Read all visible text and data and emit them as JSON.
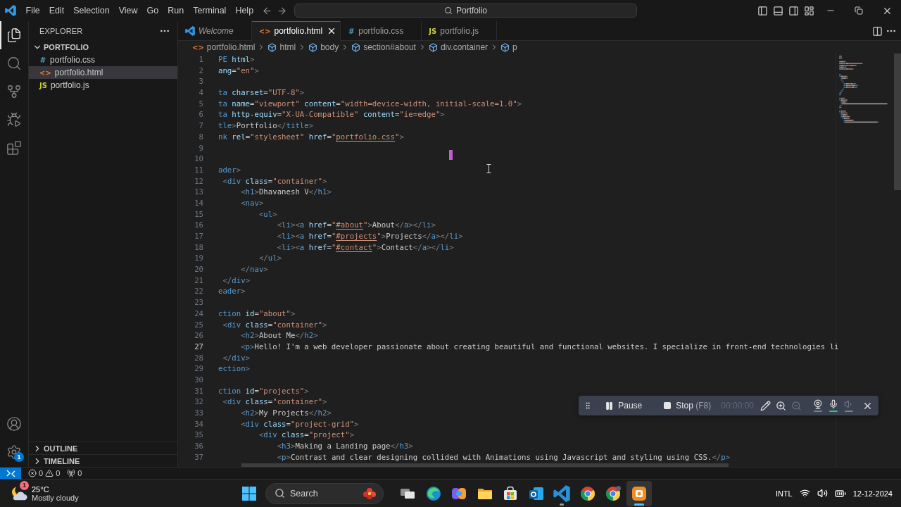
{
  "title_bar": {
    "menu": [
      "File",
      "Edit",
      "Selection",
      "View",
      "Go",
      "Run",
      "Terminal",
      "Help"
    ],
    "command_center": {
      "label": "Portfolio"
    }
  },
  "activity_bar": {
    "items": [
      {
        "kind": "explorer",
        "selected": true
      },
      {
        "kind": "search",
        "selected": false
      },
      {
        "kind": "source_control",
        "selected": false
      },
      {
        "kind": "run_debug",
        "selected": false
      },
      {
        "kind": "extensions",
        "selected": false
      }
    ],
    "settings_badge": "1"
  },
  "sidebar": {
    "title": "EXPLORER",
    "folder": {
      "name": "PORTFOLIO",
      "expanded": true,
      "files": [
        {
          "kind": "css",
          "icon": "#",
          "name": "portfolio.css",
          "selected": false
        },
        {
          "kind": "html",
          "icon": "<>",
          "name": "portfolio.html",
          "selected": true
        },
        {
          "kind": "js",
          "icon": "JS",
          "name": "portfolio.js",
          "selected": false
        }
      ]
    },
    "sections": [
      {
        "name": "OUTLINE",
        "expanded": false
      },
      {
        "name": "TIMELINE",
        "expanded": false
      }
    ]
  },
  "editor": {
    "tabs": [
      {
        "kind": "welcome",
        "label": "Welcome",
        "selected": false
      },
      {
        "kind": "html",
        "icon": "<>",
        "label": "portfolio.html",
        "selected": true
      },
      {
        "kind": "css",
        "icon": "#",
        "label": "portfolio.css",
        "selected": false
      },
      {
        "kind": "js",
        "icon": "JS",
        "label": "portfolio.js",
        "selected": false
      }
    ],
    "breadcrumbs": [
      {
        "kind": "file",
        "icon": "<>",
        "label": "portfolio.html"
      },
      {
        "kind": "element",
        "label": "html"
      },
      {
        "kind": "element",
        "label": "body"
      },
      {
        "kind": "element",
        "label": "section#about"
      },
      {
        "kind": "element",
        "label": "div.container"
      },
      {
        "kind": "element",
        "label": "p"
      }
    ],
    "lines": [
      {
        "number": "1",
        "active": false,
        "tokens": [
          {
            "kind": "tag",
            "text": "PE"
          },
          {
            "kind": "attr",
            "text": " html"
          },
          {
            "kind": "punct",
            "text": ">"
          }
        ]
      },
      {
        "number": "2",
        "active": false,
        "tokens": [
          {
            "kind": "attr",
            "text": "ang"
          },
          {
            "kind": "text",
            "text": "="
          },
          {
            "kind": "str",
            "text": "\"en\""
          },
          {
            "kind": "punct",
            "text": ">"
          }
        ]
      },
      {
        "number": "3",
        "active": false
      },
      {
        "number": "4",
        "active": false,
        "tokens": [
          {
            "kind": "tag",
            "text": "ta"
          },
          {
            "kind": "attr",
            "text": " charset"
          },
          {
            "kind": "text",
            "text": "="
          },
          {
            "kind": "str",
            "text": "\"UTF-8\""
          },
          {
            "kind": "punct",
            "text": ">"
          }
        ]
      },
      {
        "number": "5",
        "active": false,
        "tokens": [
          {
            "kind": "tag",
            "text": "ta"
          },
          {
            "kind": "attr",
            "text": " name"
          },
          {
            "kind": "text",
            "text": "="
          },
          {
            "kind": "str",
            "text": "\"viewport\""
          },
          {
            "kind": "attr",
            "text": " content"
          },
          {
            "kind": "text",
            "text": "="
          },
          {
            "kind": "str",
            "text": "\"width=device-width, initial-scale=1.0\""
          },
          {
            "kind": "punct",
            "text": ">"
          }
        ]
      },
      {
        "number": "6",
        "active": false,
        "tokens": [
          {
            "kind": "tag",
            "text": "ta"
          },
          {
            "kind": "attr",
            "text": " http-equiv"
          },
          {
            "kind": "text",
            "text": "="
          },
          {
            "kind": "str",
            "text": "\"X-UA-Compatible\""
          },
          {
            "kind": "attr",
            "text": " content"
          },
          {
            "kind": "text",
            "text": "="
          },
          {
            "kind": "str",
            "text": "\"ie=edge\""
          },
          {
            "kind": "punct",
            "text": ">"
          }
        ]
      },
      {
        "number": "7",
        "active": false,
        "tokens": [
          {
            "kind": "tag",
            "text": "tle"
          },
          {
            "kind": "punct",
            "text": ">"
          },
          {
            "kind": "text",
            "text": "Portfolio"
          },
          {
            "kind": "punct",
            "text": "</"
          },
          {
            "kind": "tag",
            "text": "title"
          },
          {
            "kind": "punct",
            "text": ">"
          }
        ]
      },
      {
        "number": "8",
        "active": false,
        "tokens": [
          {
            "kind": "tag",
            "text": "nk"
          },
          {
            "kind": "attr",
            "text": " rel"
          },
          {
            "kind": "text",
            "text": "="
          },
          {
            "kind": "str",
            "text": "\"stylesheet\""
          },
          {
            "kind": "attr",
            "text": " href"
          },
          {
            "kind": "text",
            "text": "="
          },
          {
            "kind": "str",
            "text": "\""
          },
          {
            "kind": "link",
            "text": "portfolio.css"
          },
          {
            "kind": "str",
            "text": "\""
          },
          {
            "kind": "punct",
            "text": ">"
          }
        ]
      },
      {
        "number": "9",
        "active": false
      },
      {
        "number": "10",
        "active": false
      },
      {
        "number": "11",
        "active": false,
        "tokens": [
          {
            "kind": "tag",
            "text": "ader"
          },
          {
            "kind": "punct",
            "text": ">"
          }
        ]
      },
      {
        "number": "12",
        "active": false,
        "tokens": [
          {
            "kind": "punct",
            "text": " <"
          },
          {
            "kind": "tag",
            "text": "div"
          },
          {
            "kind": "attr",
            "text": " class"
          },
          {
            "kind": "text",
            "text": "="
          },
          {
            "kind": "str",
            "text": "\"container\""
          },
          {
            "kind": "punct",
            "text": ">"
          }
        ]
      },
      {
        "number": "13",
        "active": false,
        "tokens": [
          {
            "kind": "punct",
            "text": "     <"
          },
          {
            "kind": "tag",
            "text": "h1"
          },
          {
            "kind": "punct",
            "text": ">"
          },
          {
            "kind": "text",
            "text": "Dhavanesh V"
          },
          {
            "kind": "punct",
            "text": "</"
          },
          {
            "kind": "tag",
            "text": "h1"
          },
          {
            "kind": "punct",
            "text": ">"
          }
        ]
      },
      {
        "number": "14",
        "active": false,
        "tokens": [
          {
            "kind": "punct",
            "text": "     <"
          },
          {
            "kind": "tag",
            "text": "nav"
          },
          {
            "kind": "punct",
            "text": ">"
          }
        ]
      },
      {
        "number": "15",
        "active": false,
        "tokens": [
          {
            "kind": "punct",
            "text": "         <"
          },
          {
            "kind": "tag",
            "text": "ul"
          },
          {
            "kind": "punct",
            "text": ">"
          }
        ]
      },
      {
        "number": "16",
        "active": false,
        "tokens": [
          {
            "kind": "punct",
            "text": "             <"
          },
          {
            "kind": "tag",
            "text": "li"
          },
          {
            "kind": "punct",
            "text": "><"
          },
          {
            "kind": "tag",
            "text": "a"
          },
          {
            "kind": "attr",
            "text": " href"
          },
          {
            "kind": "text",
            "text": "="
          },
          {
            "kind": "str",
            "text": "\""
          },
          {
            "kind": "link",
            "text": "#about"
          },
          {
            "kind": "str",
            "text": "\""
          },
          {
            "kind": "punct",
            "text": ">"
          },
          {
            "kind": "text",
            "text": "About"
          },
          {
            "kind": "punct",
            "text": "</"
          },
          {
            "kind": "tag",
            "text": "a"
          },
          {
            "kind": "punct",
            "text": "></"
          },
          {
            "kind": "tag",
            "text": "li"
          },
          {
            "kind": "punct",
            "text": ">"
          }
        ]
      },
      {
        "number": "17",
        "active": false,
        "tokens": [
          {
            "kind": "punct",
            "text": "             <"
          },
          {
            "kind": "tag",
            "text": "li"
          },
          {
            "kind": "punct",
            "text": "><"
          },
          {
            "kind": "tag",
            "text": "a"
          },
          {
            "kind": "attr",
            "text": " href"
          },
          {
            "kind": "text",
            "text": "="
          },
          {
            "kind": "str",
            "text": "\""
          },
          {
            "kind": "link",
            "text": "#projects"
          },
          {
            "kind": "str",
            "text": "\""
          },
          {
            "kind": "punct",
            "text": ">"
          },
          {
            "kind": "text",
            "text": "Projects"
          },
          {
            "kind": "punct",
            "text": "</"
          },
          {
            "kind": "tag",
            "text": "a"
          },
          {
            "kind": "punct",
            "text": "></"
          },
          {
            "kind": "tag",
            "text": "li"
          },
          {
            "kind": "punct",
            "text": ">"
          }
        ]
      },
      {
        "number": "18",
        "active": false,
        "tokens": [
          {
            "kind": "punct",
            "text": "             <"
          },
          {
            "kind": "tag",
            "text": "li"
          },
          {
            "kind": "punct",
            "text": "><"
          },
          {
            "kind": "tag",
            "text": "a"
          },
          {
            "kind": "attr",
            "text": " href"
          },
          {
            "kind": "text",
            "text": "="
          },
          {
            "kind": "str",
            "text": "\""
          },
          {
            "kind": "link",
            "text": "#contact"
          },
          {
            "kind": "str",
            "text": "\""
          },
          {
            "kind": "punct",
            "text": ">"
          },
          {
            "kind": "text",
            "text": "Contact"
          },
          {
            "kind": "punct",
            "text": "</"
          },
          {
            "kind": "tag",
            "text": "a"
          },
          {
            "kind": "punct",
            "text": "></"
          },
          {
            "kind": "tag",
            "text": "li"
          },
          {
            "kind": "punct",
            "text": ">"
          }
        ]
      },
      {
        "number": "19",
        "active": false,
        "tokens": [
          {
            "kind": "punct",
            "text": "         </"
          },
          {
            "kind": "tag",
            "text": "ul"
          },
          {
            "kind": "punct",
            "text": ">"
          }
        ]
      },
      {
        "number": "20",
        "active": false,
        "tokens": [
          {
            "kind": "punct",
            "text": "     </"
          },
          {
            "kind": "tag",
            "text": "nav"
          },
          {
            "kind": "punct",
            "text": ">"
          }
        ]
      },
      {
        "number": "21",
        "active": false,
        "tokens": [
          {
            "kind": "punct",
            "text": " </"
          },
          {
            "kind": "tag",
            "text": "div"
          },
          {
            "kind": "punct",
            "text": ">"
          }
        ]
      },
      {
        "number": "22",
        "active": false,
        "tokens": [
          {
            "kind": "tag",
            "text": "eader"
          },
          {
            "kind": "punct",
            "text": ">"
          }
        ]
      },
      {
        "number": "23",
        "active": false
      },
      {
        "number": "24",
        "active": false,
        "tokens": [
          {
            "kind": "tag",
            "text": "ction"
          },
          {
            "kind": "attr",
            "text": " id"
          },
          {
            "kind": "text",
            "text": "="
          },
          {
            "kind": "str",
            "text": "\"about\""
          },
          {
            "kind": "punct",
            "text": ">"
          }
        ]
      },
      {
        "number": "25",
        "active": false,
        "tokens": [
          {
            "kind": "punct",
            "text": " <"
          },
          {
            "kind": "tag",
            "text": "div"
          },
          {
            "kind": "attr",
            "text": " class"
          },
          {
            "kind": "text",
            "text": "="
          },
          {
            "kind": "str",
            "text": "\"container\""
          },
          {
            "kind": "punct",
            "text": ">"
          }
        ]
      },
      {
        "number": "26",
        "active": false,
        "tokens": [
          {
            "kind": "punct",
            "text": "     <"
          },
          {
            "kind": "tag",
            "text": "h2"
          },
          {
            "kind": "punct",
            "text": ">"
          },
          {
            "kind": "text",
            "text": "About Me"
          },
          {
            "kind": "punct",
            "text": "</"
          },
          {
            "kind": "tag",
            "text": "h2"
          },
          {
            "kind": "punct",
            "text": ">"
          }
        ]
      },
      {
        "number": "27",
        "active": true,
        "tokens": [
          {
            "kind": "punct",
            "text": "     <"
          },
          {
            "kind": "tag",
            "text": "p"
          },
          {
            "kind": "punct",
            "text": ">"
          },
          {
            "kind": "text",
            "text": "Hello! I'm a web developer passionate about creating beautiful and functional websites. I specialize in front-end technologies li"
          }
        ]
      },
      {
        "number": "28",
        "active": false,
        "tokens": [
          {
            "kind": "punct",
            "text": " </"
          },
          {
            "kind": "tag",
            "text": "div"
          },
          {
            "kind": "punct",
            "text": ">"
          }
        ]
      },
      {
        "number": "29",
        "active": false,
        "tokens": [
          {
            "kind": "tag",
            "text": "ection"
          },
          {
            "kind": "punct",
            "text": ">"
          }
        ]
      },
      {
        "number": "30",
        "active": false
      },
      {
        "number": "31",
        "active": false,
        "tokens": [
          {
            "kind": "tag",
            "text": "ction"
          },
          {
            "kind": "attr",
            "text": " id"
          },
          {
            "kind": "text",
            "text": "="
          },
          {
            "kind": "str",
            "text": "\"projects\""
          },
          {
            "kind": "punct",
            "text": ">"
          }
        ]
      },
      {
        "number": "32",
        "active": false,
        "tokens": [
          {
            "kind": "punct",
            "text": " <"
          },
          {
            "kind": "tag",
            "text": "div"
          },
          {
            "kind": "attr",
            "text": " class"
          },
          {
            "kind": "text",
            "text": "="
          },
          {
            "kind": "str",
            "text": "\"container\""
          },
          {
            "kind": "punct",
            "text": ">"
          }
        ]
      },
      {
        "number": "33",
        "active": false,
        "tokens": [
          {
            "kind": "punct",
            "text": "     <"
          },
          {
            "kind": "tag",
            "text": "h2"
          },
          {
            "kind": "punct",
            "text": ">"
          },
          {
            "kind": "text",
            "text": "My Projects"
          },
          {
            "kind": "punct",
            "text": "</"
          },
          {
            "kind": "tag",
            "text": "h2"
          },
          {
            "kind": "punct",
            "text": ">"
          }
        ]
      },
      {
        "number": "34",
        "active": false,
        "tokens": [
          {
            "kind": "punct",
            "text": "     <"
          },
          {
            "kind": "tag",
            "text": "div"
          },
          {
            "kind": "attr",
            "text": " class"
          },
          {
            "kind": "text",
            "text": "="
          },
          {
            "kind": "str",
            "text": "\"project-grid\""
          },
          {
            "kind": "punct",
            "text": ">"
          }
        ]
      },
      {
        "number": "35",
        "active": false,
        "tokens": [
          {
            "kind": "punct",
            "text": "         <"
          },
          {
            "kind": "tag",
            "text": "div"
          },
          {
            "kind": "attr",
            "text": " class"
          },
          {
            "kind": "text",
            "text": "="
          },
          {
            "kind": "str",
            "text": "\"project\""
          },
          {
            "kind": "punct",
            "text": ">"
          }
        ]
      },
      {
        "number": "36",
        "active": false,
        "tokens": [
          {
            "kind": "punct",
            "text": "             <"
          },
          {
            "kind": "tag",
            "text": "h3"
          },
          {
            "kind": "punct",
            "text": ">"
          },
          {
            "kind": "text",
            "text": "Making a Landing page"
          },
          {
            "kind": "punct",
            "text": "</"
          },
          {
            "kind": "tag",
            "text": "h3"
          },
          {
            "kind": "punct",
            "text": ">"
          }
        ]
      },
      {
        "number": "37",
        "active": false,
        "tokens": [
          {
            "kind": "punct",
            "text": "             <"
          },
          {
            "kind": "tag",
            "text": "p"
          },
          {
            "kind": "punct",
            "text": ">"
          },
          {
            "kind": "text",
            "text": "Contrast and clear designing collided with Animations using Javascript and styling using CSS."
          },
          {
            "kind": "punct",
            "text": "</"
          },
          {
            "kind": "tag",
            "text": "p"
          },
          {
            "kind": "punct",
            "text": ">"
          }
        ]
      }
    ]
  },
  "status_bar": {
    "errors": "0",
    "warnings": "0",
    "ports": "0"
  },
  "recorder": {
    "pause": "Pause",
    "stop": "Stop",
    "stop_shortcut": "(F8)",
    "timer": "00:00:00",
    "tools": [
      {
        "kind": "pencil",
        "disabled": false
      },
      {
        "kind": "zoom_in",
        "disabled": false
      },
      {
        "kind": "zoom_out",
        "disabled": true
      }
    ],
    "toggles": [
      {
        "kind": "webcam",
        "on": false,
        "disabled": false
      },
      {
        "kind": "microphone",
        "on": true,
        "disabled": false
      },
      {
        "kind": "speaker",
        "on": false,
        "disabled": true
      }
    ]
  },
  "taskbar": {
    "weather": {
      "temperature": "25°C",
      "condition": "Mostly cloudy",
      "badge": "1"
    },
    "search": {
      "label": "Search"
    },
    "apps": [
      {
        "kind": "task_view",
        "open": false,
        "selected": false
      },
      {
        "kind": "edge",
        "open": false,
        "selected": false
      },
      {
        "kind": "copilot",
        "open": false,
        "selected": false
      },
      {
        "kind": "file_explorer",
        "open": false,
        "selected": false
      },
      {
        "kind": "store",
        "open": false,
        "selected": false
      },
      {
        "kind": "outlook",
        "open": false,
        "selected": false
      },
      {
        "kind": "vscode",
        "open": true,
        "selected": false
      },
      {
        "kind": "chrome",
        "open": false,
        "selected": false
      },
      {
        "kind": "chrome_profile",
        "open": false,
        "selected": false
      },
      {
        "kind": "recorder",
        "open": true,
        "selected": true
      }
    ],
    "tray": {
      "language": "INTL",
      "date": "12-12-2024"
    }
  }
}
